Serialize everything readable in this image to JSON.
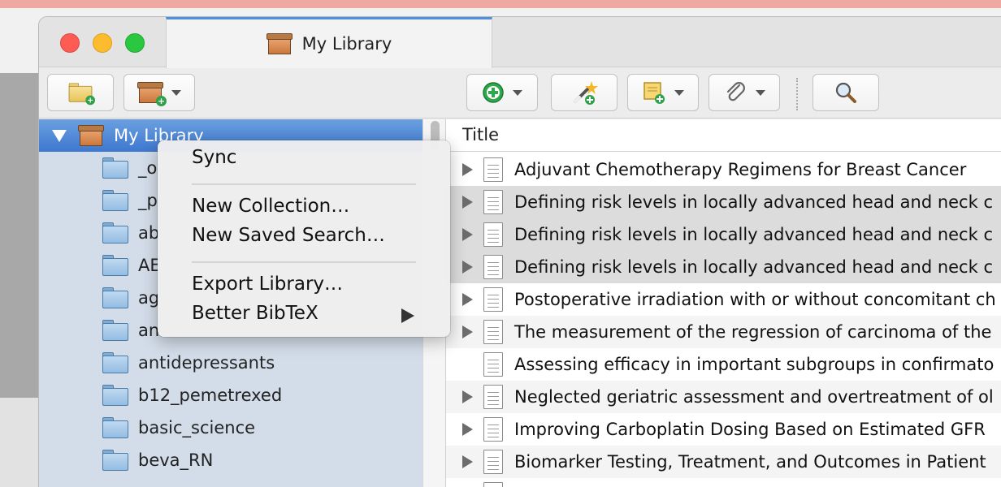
{
  "window": {
    "tab_title": "My Library"
  },
  "toolbar": {
    "buttons": [
      "new-collection",
      "new-library",
      "new-item",
      "add-by-identifier",
      "new-note",
      "add-attachment",
      "search"
    ]
  },
  "sidebar": {
    "library_label": "My Library",
    "collections": [
      {
        "label": "_o"
      },
      {
        "label": "_p"
      },
      {
        "label": "ab"
      },
      {
        "label": "AE"
      },
      {
        "label": "ag"
      },
      {
        "label": "an"
      },
      {
        "label": "antidepressants"
      },
      {
        "label": "b12_pemetrexed"
      },
      {
        "label": "basic_science"
      },
      {
        "label": "beva_RN"
      }
    ]
  },
  "items": {
    "column_title": "Title",
    "rows": [
      {
        "title": "Adjuvant Chemotherapy Regimens for Breast Cancer"
      },
      {
        "title": "Defining risk levels in locally advanced head and neck c"
      },
      {
        "title": "Defining risk levels in locally advanced head and neck c"
      },
      {
        "title": "Defining risk levels in locally advanced head and neck c"
      },
      {
        "title": "Postoperative irradiation with or without concomitant ch"
      },
      {
        "title": "The measurement of the regression of carcinoma of the"
      },
      {
        "title": "Assessing efficacy in important subgroups in confirmato"
      },
      {
        "title": "Neglected geriatric assessment and overtreatment of ol"
      },
      {
        "title": "Improving Carboplatin Dosing Based on Estimated GFR"
      },
      {
        "title": "Biomarker Testing, Treatment, and Outcomes in Patient"
      }
    ]
  },
  "context_menu": {
    "sync": "Sync",
    "new_collection": "New Collection…",
    "new_saved_search": "New Saved Search…",
    "export_library": "Export Library…",
    "better_bibtex": "Better BibTeX"
  },
  "colors": {
    "selection": "#3e78cf",
    "sidebar_bg": "#d3dde9",
    "accent": "#4a8fe0"
  }
}
